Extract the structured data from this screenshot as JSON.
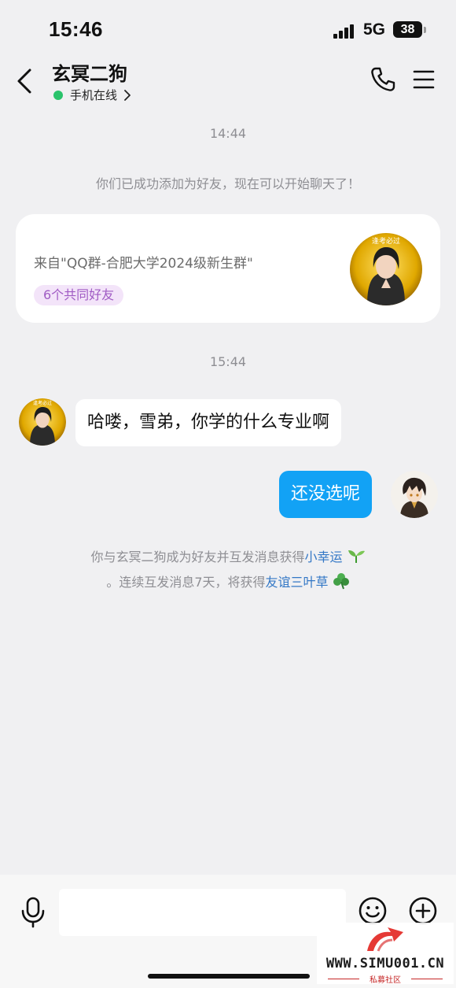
{
  "status_bar": {
    "time": "15:46",
    "network": "5G",
    "battery": "38"
  },
  "header": {
    "contact_name": "玄冥二狗",
    "presence": "手机在线"
  },
  "chat": {
    "timestamp_1": "14:44",
    "system_added": "你们已成功添加为好友，现在可以开始聊天了！",
    "source_card": {
      "source": "来自\"QQ群-合肥大学2024级新生群\"",
      "mutual_friends": "6个共同好友",
      "avatar_caption": "逢考必过"
    },
    "timestamp_2": "15:44",
    "messages": [
      {
        "sender": "contact",
        "text": "哈喽，雪弟，你学的什么专业啊",
        "avatar_caption": "逢考必过"
      },
      {
        "sender": "me",
        "text": "还没选呢"
      }
    ],
    "notice": {
      "part1": "你与玄冥二狗成为好友并互发消息获得",
      "link1": "小幸运",
      "part2": "。连续互发消息7天，将获得",
      "link2": "友谊三叶草"
    }
  },
  "input": {
    "placeholder": ""
  },
  "watermark": {
    "text": "WWW.SIMU001.CN",
    "sub": "私募社区"
  },
  "colors": {
    "background": "#f0f0f2",
    "outgoing_bubble": "#12a2f5",
    "online": "#2ac36b",
    "badge_text": "#a05bc4",
    "link": "#3478c6"
  }
}
